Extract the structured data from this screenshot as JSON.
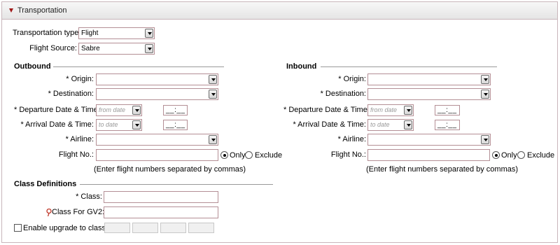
{
  "panel": {
    "title": "Transportation"
  },
  "top": {
    "transport_type_label": "Transportation type:",
    "transport_type_value": "Flight",
    "flight_source_label": "Flight Source:",
    "flight_source_value": "Sabre"
  },
  "outbound": {
    "title": "Outbound",
    "origin_label": "* Origin:",
    "destination_label": "* Destination:",
    "departure_label": "* Departure Date & Time:",
    "departure_date_placeholder": "from date",
    "departure_time": "__:__",
    "arrival_label": "* Arrival Date & Time:",
    "arrival_date_placeholder": "to date",
    "arrival_time": "__:__",
    "airline_label": "* Airline:",
    "flight_no_label": "Flight No.:",
    "only_label": "Only",
    "exclude_label": "Exclude",
    "hint": "(Enter flight numbers separated by commas)",
    "filter_selected": "only"
  },
  "inbound": {
    "title": "Inbound",
    "origin_label": "* Origin:",
    "destination_label": "* Destination:",
    "departure_label": "* Departure Date & Time:",
    "departure_date_placeholder": "from date",
    "departure_time": "__:__",
    "arrival_label": "* Arrival Date & Time:",
    "arrival_date_placeholder": "to date",
    "arrival_time": "__:__",
    "airline_label": "* Airline:",
    "flight_no_label": "Flight No.:",
    "only_label": "Only",
    "exclude_label": "Exclude",
    "hint": "(Enter flight numbers separated by commas)",
    "filter_selected": "only"
  },
  "class_definitions": {
    "title": "Class Definitions",
    "class_label": "* Class:",
    "class_gv2_label": "Class For GV2:",
    "upgrade_label": "Enable upgrade to class",
    "upgrade_checked": false
  },
  "icons": {
    "collapse": "triangle-down-icon",
    "dropdown": "chevron-down-icon",
    "pin": "pin-icon"
  },
  "colors": {
    "field_border": "#b48f95",
    "collapse_triangle": "#a01818",
    "pin": "#c0392b"
  }
}
